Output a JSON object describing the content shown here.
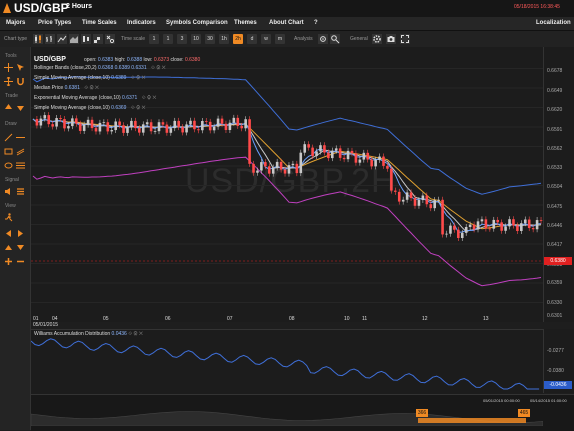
{
  "header": {
    "pair": "USD/GBP",
    "period": "2 Hours",
    "datetime": "05/18/2015 16:38:45"
  },
  "menu": {
    "items": [
      "Majors",
      "Price Types",
      "Time Scales",
      "Indicators",
      "Symbols Comparison",
      "Themes",
      "About Chart",
      "?"
    ],
    "right": "Localization"
  },
  "toolbar": {
    "chart_type_label": "Chart type",
    "time_scale_label": "Time scale",
    "time_scale_buttons": [
      "1",
      "1",
      "3",
      "10",
      "30",
      "1h",
      "2h",
      "d",
      "w",
      "m"
    ],
    "active_time_scale": "2h",
    "analysis_label": "Analysis",
    "general_label": "General"
  },
  "sidebar": {
    "tools_label": "Tools",
    "trade_label": "Trade",
    "draw_label": "Draw",
    "signal_label": "Signal",
    "view_label": "View"
  },
  "chart": {
    "title": "USD/GBP",
    "watermark": "USD/GBP,2H",
    "ohlc": {
      "open_label": "open:",
      "open": "0.6383",
      "high_label": "high:",
      "high": "0.6388",
      "low_label": "low:",
      "low": "0.6373",
      "close_label": "close:",
      "close": "0.6380"
    },
    "indicators": [
      {
        "label": "Bollinger Bands (close,20,2)",
        "values": "0.6368  0.6389  0.6331"
      },
      {
        "label": "Simple Moving Average (close,10)",
        "values": "0.6389"
      },
      {
        "label": "Median Price",
        "values": "0.6381"
      },
      {
        "label": "Exponential Moving Average (close,10)",
        "values": "0.6371"
      },
      {
        "label": "Simple Moving Average (close,10)",
        "values": "0.6369"
      }
    ],
    "indicator_tools": "⟐ ⚙ ✕",
    "price_ticks": [
      "0.6678",
      "0.6649",
      "0.6620",
      "0.6591",
      "0.6562",
      "0.6533",
      "0.6504",
      "0.6475",
      "0.6446",
      "0.6417",
      "0.6388",
      "0.6359",
      "0.6330",
      "0.6301"
    ],
    "current_price": "0.6380",
    "x_ticks": [
      "01",
      "04",
      "05",
      "06",
      "07",
      "08",
      "10",
      "11",
      "12",
      "13"
    ],
    "x_date": "05/01/2015",
    "colors": {
      "candle_up": "#c8c8c8",
      "candle_down": "#ff4a4a",
      "bb_upper": "#3f6fd8",
      "bb_lower": "#c040c0",
      "sma": "#e0a030",
      "ema": "#c8c8c8",
      "sma2": "#6aa0ff",
      "accent": "#f08a24"
    }
  },
  "sub_chart": {
    "title": "Williams Accumulation Distribution",
    "value": "0.0436",
    "ticks": [
      "-0.0277",
      "-0.0380"
    ],
    "current": "-0.0436"
  },
  "navigator": {
    "start_date": "05/01/2015 00:00:00",
    "end_date": "05/14/2015 01:00:00",
    "start_handle": "366",
    "end_handle": "465"
  }
}
